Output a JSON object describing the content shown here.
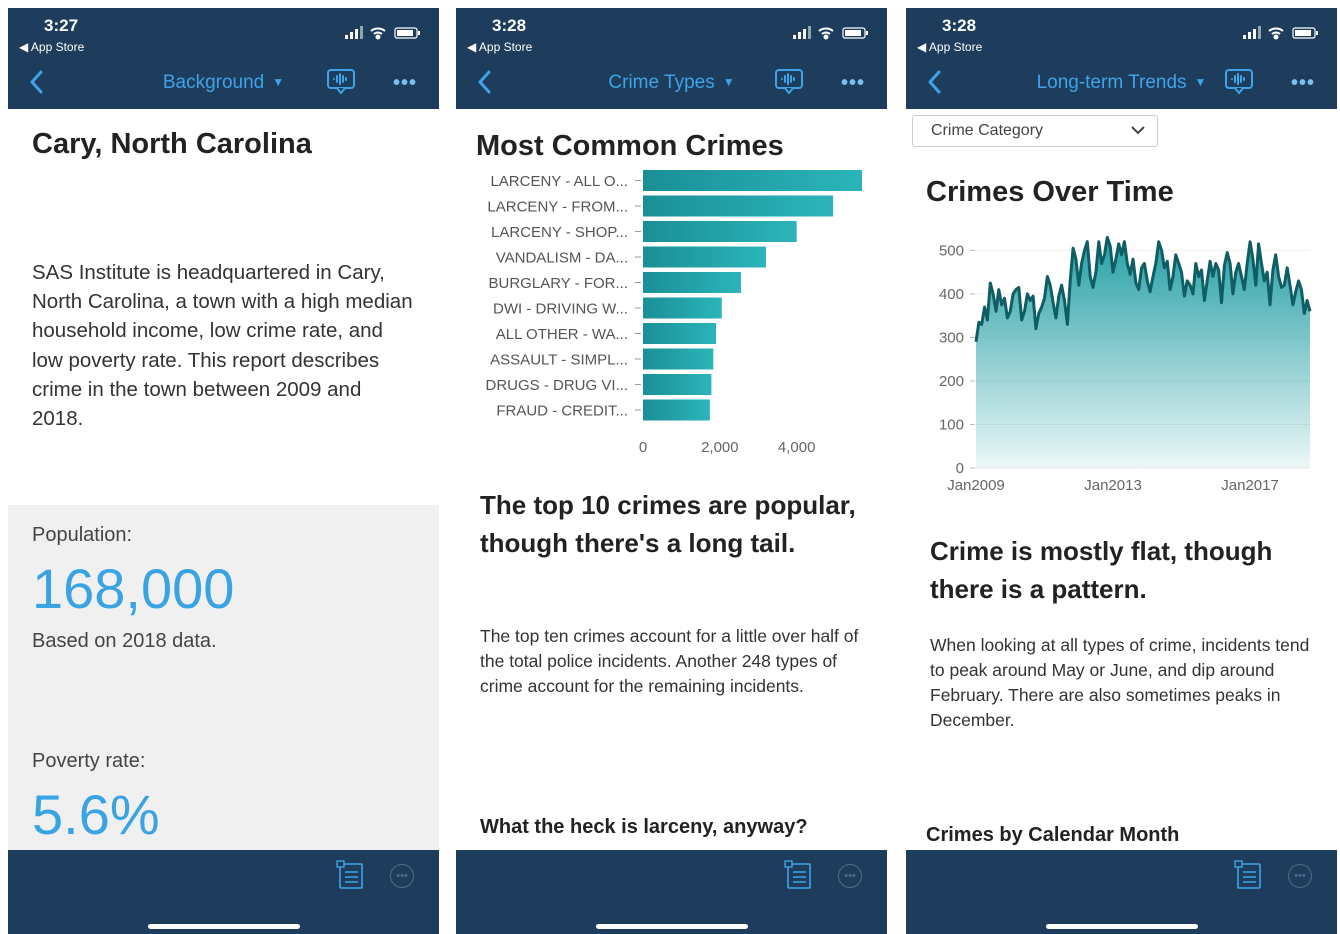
{
  "panels": [
    {
      "status": {
        "time": "3:27",
        "back_app": "◀ App Store"
      },
      "nav": {
        "title": "Background"
      },
      "content": {
        "title": "Cary, North Carolina",
        "description": "SAS Institute is headquartered in Cary, North Carolina, a town with a high median household income, low crime rate, and low poverty rate. This report describes crime in the town between 2009 and 2018.",
        "population_label": "Population:",
        "population_value": "168,000",
        "population_note": "Based on 2018 data.",
        "poverty_label": "Poverty rate:",
        "poverty_value": "5.6%"
      }
    },
    {
      "status": {
        "time": "3:28",
        "back_app": "◀ App Store"
      },
      "nav": {
        "title": "Crime Types"
      },
      "content": {
        "title": "Most Common Crimes",
        "heading": "The top 10 crimes are popular, though there's a long tail.",
        "body": "The top ten crimes account for a little over half of the total police incidents. Another 248 types of crime account for the remaining incidents.",
        "subheading": "What the heck is larceny, anyway?"
      }
    },
    {
      "status": {
        "time": "3:28",
        "back_app": "◀ App Store"
      },
      "nav": {
        "title": "Long-term Trends"
      },
      "content": {
        "dropdown": "Crime Category",
        "title": "Crimes Over Time",
        "heading": "Crime is mostly flat, though there is a pattern.",
        "body": "When looking at all types of crime, incidents tend to peak around May or June, and dip around February. There are also sometimes peaks in December.",
        "subheading": "Crimes by Calendar Month"
      }
    }
  ],
  "colors": {
    "navbar": "#1e3d5c",
    "accent": "#3ea3e8",
    "value_blue": "#3aa3e3",
    "teal": "#1a9ba1",
    "line": "#0f5e63"
  },
  "icons": [
    "back-chevron-icon",
    "dropdown-caret-icon",
    "voice-icon",
    "more-dots-icon",
    "list-icon",
    "more-circle-icon",
    "signal-icon",
    "wifi-icon",
    "battery-icon"
  ],
  "chart_data": [
    {
      "type": "bar",
      "orientation": "horizontal",
      "title": "Most Common Crimes",
      "categories": [
        "LARCENY - ALL O...",
        "LARCENY - FROM...",
        "LARCENY - SHOP...",
        "VANDALISM - DA...",
        "BURGLARY - FOR...",
        "DWI - DRIVING W...",
        "ALL OTHER - WA...",
        "ASSAULT - SIMPL...",
        "DRUGS - DRUG VI...",
        "FRAUD - CREDIT..."
      ],
      "values": [
        5700,
        4950,
        4000,
        3200,
        2550,
        2050,
        1900,
        1830,
        1780,
        1740
      ],
      "xticks": [
        "0",
        "2,000",
        "4,000"
      ],
      "xlim": [
        0,
        5700
      ],
      "grid": false
    },
    {
      "type": "area",
      "title": "Crimes Over Time",
      "xticks": [
        "Jan2009",
        "Jan2013",
        "Jan2017"
      ],
      "yticks": [
        "0",
        "100",
        "200",
        "300",
        "400",
        "500"
      ],
      "ylim": [
        0,
        540
      ],
      "x_start": "Jan2009",
      "x_end": "Oct2018",
      "y": [
        290,
        335,
        330,
        370,
        340,
        425,
        400,
        360,
        410,
        375,
        390,
        345,
        360,
        400,
        410,
        415,
        340,
        360,
        400,
        385,
        395,
        320,
        355,
        370,
        390,
        440,
        420,
        380,
        345,
        395,
        420,
        385,
        330,
        430,
        505,
        480,
        420,
        470,
        500,
        520,
        440,
        415,
        450,
        520,
        470,
        490,
        530,
        510,
        450,
        480,
        515,
        490,
        520,
        470,
        445,
        480,
        425,
        410,
        460,
        470,
        430,
        405,
        440,
        470,
        520,
        500,
        460,
        475,
        410,
        440,
        490,
        470,
        450,
        395,
        430,
        420,
        400,
        470,
        440,
        455,
        385,
        430,
        475,
        440,
        470,
        455,
        380,
        465,
        495,
        470,
        400,
        450,
        470,
        440,
        410,
        470,
        520,
        480,
        420,
        515,
        470,
        430,
        450,
        375,
        455,
        490,
        440,
        415,
        420,
        460,
        420,
        375,
        405,
        430,
        410,
        355,
        385,
        360
      ],
      "grid": true
    }
  ]
}
